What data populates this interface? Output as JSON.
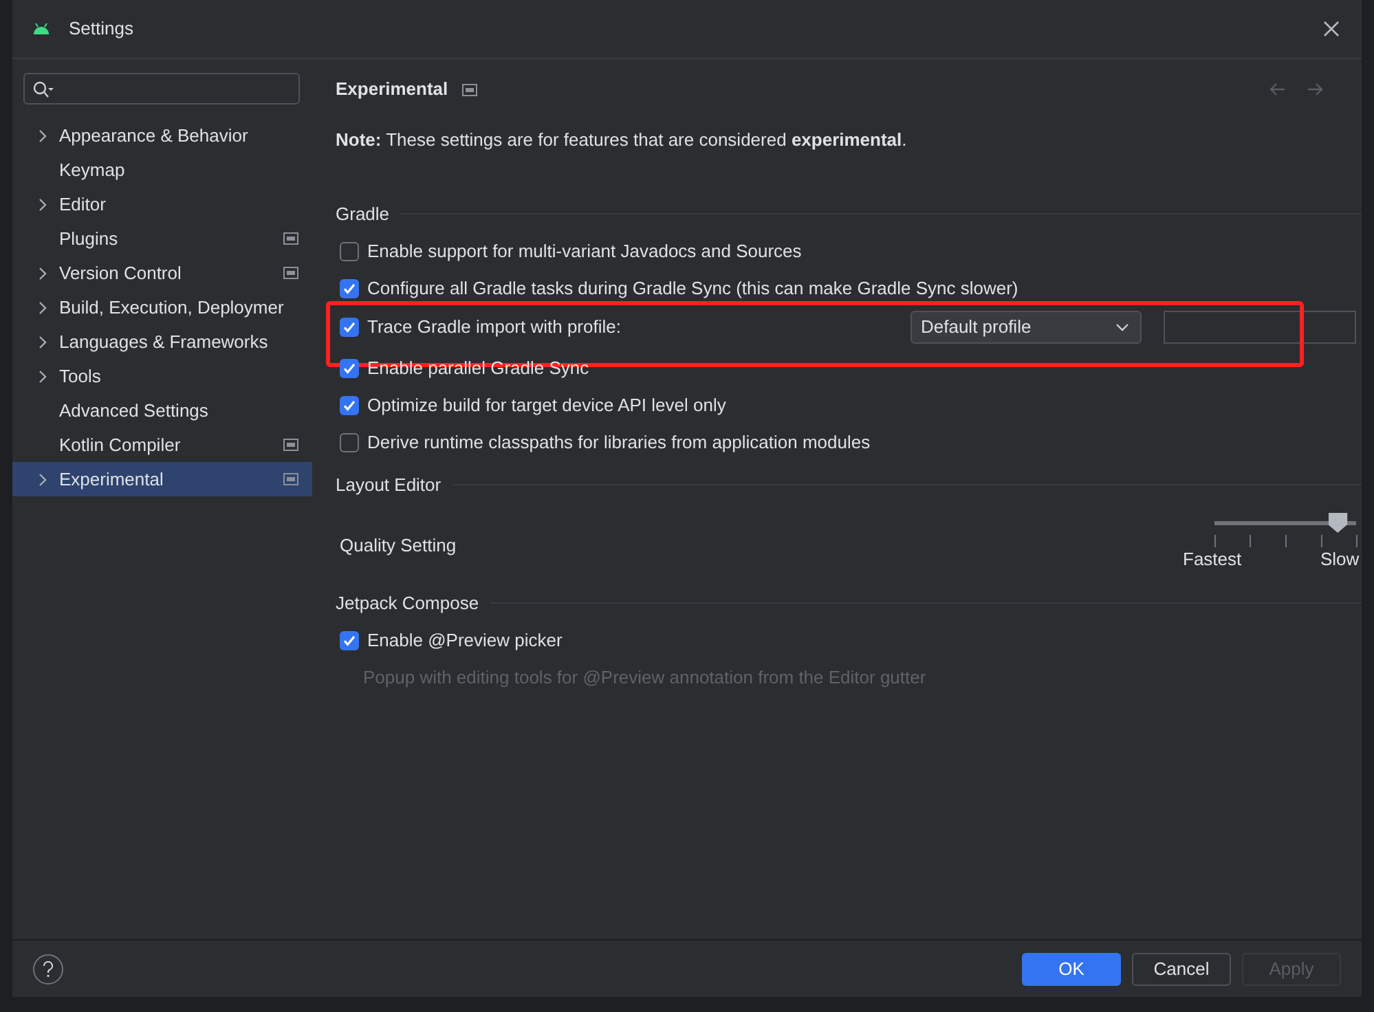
{
  "window": {
    "title": "Settings"
  },
  "sidebar": {
    "items": [
      {
        "label": "Appearance & Behavior",
        "expandable": true,
        "project_level": false,
        "selected": false
      },
      {
        "label": "Keymap",
        "expandable": false,
        "project_level": false,
        "selected": false
      },
      {
        "label": "Editor",
        "expandable": true,
        "project_level": false,
        "selected": false
      },
      {
        "label": "Plugins",
        "expandable": false,
        "project_level": true,
        "selected": false
      },
      {
        "label": "Version Control",
        "expandable": true,
        "project_level": true,
        "selected": false
      },
      {
        "label": "Build, Execution, Deploymer",
        "expandable": true,
        "project_level": false,
        "selected": false
      },
      {
        "label": "Languages & Frameworks",
        "expandable": true,
        "project_level": false,
        "selected": false
      },
      {
        "label": "Tools",
        "expandable": true,
        "project_level": false,
        "selected": false
      },
      {
        "label": "Advanced Settings",
        "expandable": false,
        "project_level": false,
        "selected": false
      },
      {
        "label": "Kotlin Compiler",
        "expandable": false,
        "project_level": true,
        "selected": false
      },
      {
        "label": "Experimental",
        "expandable": true,
        "project_level": true,
        "selected": true
      }
    ]
  },
  "content": {
    "title": "Experimental",
    "note": "**Note:** These settings are for features that are considered **experimental**.",
    "sections": [
      {
        "heading": "Gradle",
        "items": [
          {
            "kind": "checkbox",
            "label": "Enable support for multi-variant Javadocs and Sources",
            "checked": false
          },
          {
            "kind": "checkbox",
            "label": "Configure all Gradle tasks during Gradle Sync (this can make Gradle Sync slower)",
            "checked": true
          },
          {
            "kind": "profile",
            "label": "Trace Gradle import with profile:",
            "checked": true,
            "dropdown": "Default profile",
            "highlighted": true
          },
          {
            "kind": "checkbox",
            "label": "Enable parallel Gradle Sync",
            "checked": true
          },
          {
            "kind": "checkbox",
            "label": "Optimize build for target device API level only",
            "checked": true
          },
          {
            "kind": "checkbox",
            "label": "Derive runtime classpaths for libraries from application modules",
            "checked": false
          }
        ]
      },
      {
        "heading": "Layout Editor",
        "items": [
          {
            "kind": "slider",
            "label": "Quality Setting",
            "level": 0.87,
            "min_label": "Fastest",
            "max_label": "Slow"
          }
        ]
      },
      {
        "heading": "Jetpack Compose",
        "items": [
          {
            "kind": "checkbox",
            "label": "Enable @Preview picker",
            "checked": true,
            "hint": "Popup with editing tools for @Preview annotation from the Editor gutter"
          }
        ]
      }
    ]
  },
  "buttons": [
    {
      "label": "OK",
      "kind": "primary",
      "disabled": false
    },
    {
      "label": "Cancel",
      "kind": "normal",
      "disabled": false
    },
    {
      "label": "Apply",
      "kind": "normal",
      "disabled": true
    }
  ]
}
